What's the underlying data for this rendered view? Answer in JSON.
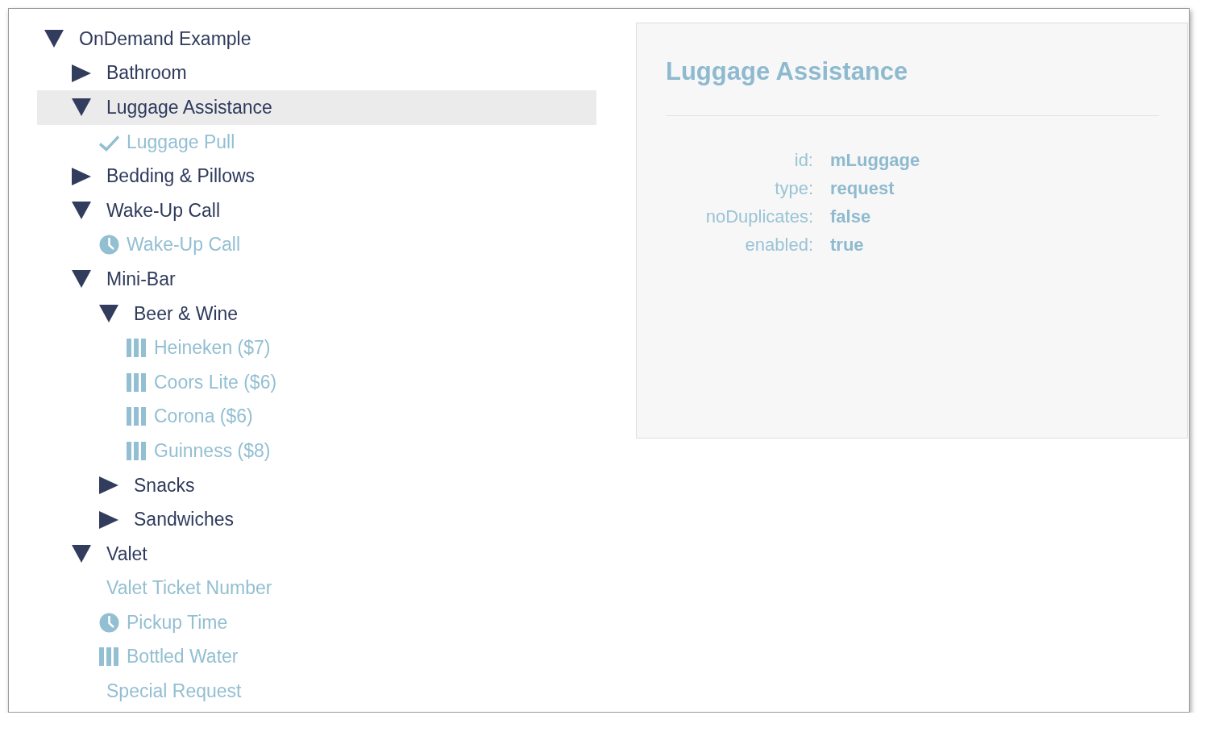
{
  "tree": [
    {
      "label": "OnDemand Example",
      "kind": "group",
      "expanded": true,
      "selected": false,
      "children": [
        {
          "label": "Bathroom",
          "kind": "group",
          "expanded": false,
          "selected": false
        },
        {
          "label": "Luggage Assistance",
          "kind": "group",
          "expanded": true,
          "selected": true,
          "children": [
            {
              "label": "Luggage Pull",
              "kind": "check",
              "selected": false
            }
          ]
        },
        {
          "label": "Bedding & Pillows",
          "kind": "group",
          "expanded": false,
          "selected": false
        },
        {
          "label": "Wake-Up Call",
          "kind": "group",
          "expanded": true,
          "selected": false,
          "children": [
            {
              "label": "Wake-Up Call",
              "kind": "clock",
              "selected": false
            }
          ]
        },
        {
          "label": "Mini-Bar",
          "kind": "group",
          "expanded": true,
          "selected": false,
          "children": [
            {
              "label": "Beer & Wine",
              "kind": "group",
              "expanded": true,
              "selected": false,
              "children": [
                {
                  "label": "Heineken ($7)",
                  "kind": "bars",
                  "selected": false
                },
                {
                  "label": "Coors Lite ($6)",
                  "kind": "bars",
                  "selected": false
                },
                {
                  "label": "Corona ($6)",
                  "kind": "bars",
                  "selected": false
                },
                {
                  "label": "Guinness ($8)",
                  "kind": "bars",
                  "selected": false
                }
              ]
            },
            {
              "label": "Snacks",
              "kind": "group",
              "expanded": false,
              "selected": false
            },
            {
              "label": "Sandwiches",
              "kind": "group",
              "expanded": false,
              "selected": false
            }
          ]
        },
        {
          "label": "Valet",
          "kind": "group",
          "expanded": true,
          "selected": false,
          "children": [
            {
              "label": "Valet Ticket Number",
              "kind": "text",
              "selected": false
            },
            {
              "label": "Pickup Time",
              "kind": "clock",
              "selected": false
            },
            {
              "label": "Bottled Water",
              "kind": "bars",
              "selected": false
            },
            {
              "label": "Special Request",
              "kind": "text",
              "selected": false
            }
          ]
        }
      ]
    }
  ],
  "details": {
    "title": "Luggage Assistance",
    "properties": [
      {
        "label": "id:",
        "value": "mLuggage"
      },
      {
        "label": "type:",
        "value": "request"
      },
      {
        "label": "noDuplicates:",
        "value": "false"
      },
      {
        "label": "enabled:",
        "value": "true"
      }
    ]
  }
}
